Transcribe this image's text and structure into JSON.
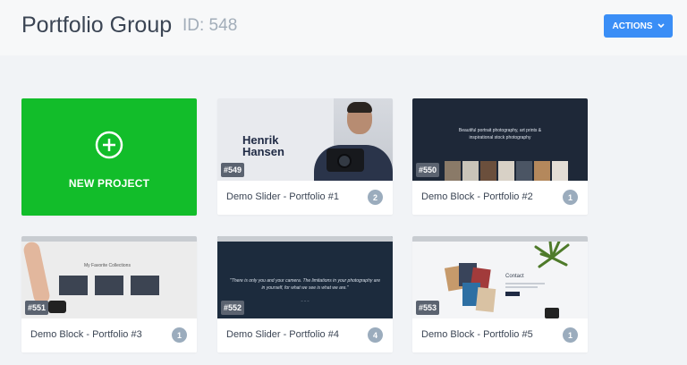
{
  "header": {
    "title": "Portfolio Group",
    "group_id": "ID: 548",
    "actions_label": "ACTIONS"
  },
  "new_project": {
    "label": "NEW PROJECT"
  },
  "projects": [
    {
      "id": "#549",
      "name": "Demo Slider - Portfolio #1",
      "count": "2",
      "thumb": {
        "heading_line1": "Henrik",
        "heading_line2": "Hansen"
      }
    },
    {
      "id": "#550",
      "name": "Demo Block - Portfolio #2",
      "count": "1",
      "thumb": {
        "text_line1": "Beautiful portrait photography, art prints &",
        "text_line2": "inspirational stock photography"
      }
    },
    {
      "id": "#551",
      "name": "Demo Block - Portfolio #3",
      "count": "1",
      "thumb": {
        "text": "My Favorite Collections"
      }
    },
    {
      "id": "#552",
      "name": "Demo Slider - Portfolio #4",
      "count": "4",
      "thumb": {
        "quote": "\"There is only you and your camera. The limitations in your photography are in yourself, for what we see is what we are.\""
      }
    },
    {
      "id": "#553",
      "name": "Demo Block - Portfolio #5",
      "count": "1",
      "thumb": {
        "text": "Contact"
      }
    }
  ],
  "colors": {
    "accent": "#3a8ef6",
    "new_project_bg": "#12bd2a",
    "badge": "#9bacbd"
  }
}
